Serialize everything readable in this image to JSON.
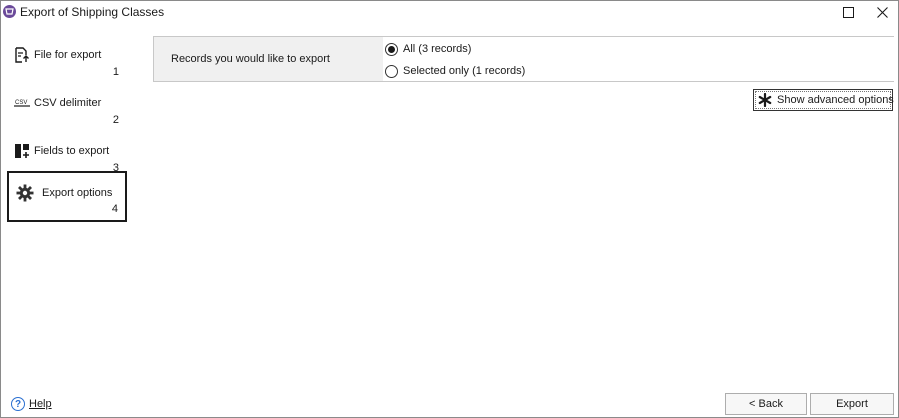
{
  "window": {
    "title": "Export of Shipping Classes",
    "icon": "app-logo-icon",
    "controls": [
      "maximize-icon",
      "close-icon"
    ]
  },
  "sidebar": {
    "steps": [
      {
        "label": "File for export",
        "number": "1",
        "icon": "file-export-icon",
        "active": false
      },
      {
        "label": "CSV delimiter",
        "number": "2",
        "icon": "csv-icon",
        "active": false
      },
      {
        "label": "Fields to export",
        "number": "3",
        "icon": "fields-add-icon",
        "active": false
      },
      {
        "label": "Export options",
        "number": "4",
        "icon": "gear-icon",
        "active": true
      }
    ]
  },
  "main": {
    "records_label": "Records you would like to export",
    "options": [
      {
        "label": "All (3 records)",
        "selected": true
      },
      {
        "label": "Selected only (1 records)",
        "selected": false
      }
    ],
    "advanced_button": "Show advanced options"
  },
  "footer": {
    "help_label": "Help",
    "back_label": "< Back",
    "export_label": "Export"
  },
  "colors": {
    "accent": "#6b4a9a",
    "help": "#2a6fd1",
    "panel_bg": "#f0f0f0"
  }
}
